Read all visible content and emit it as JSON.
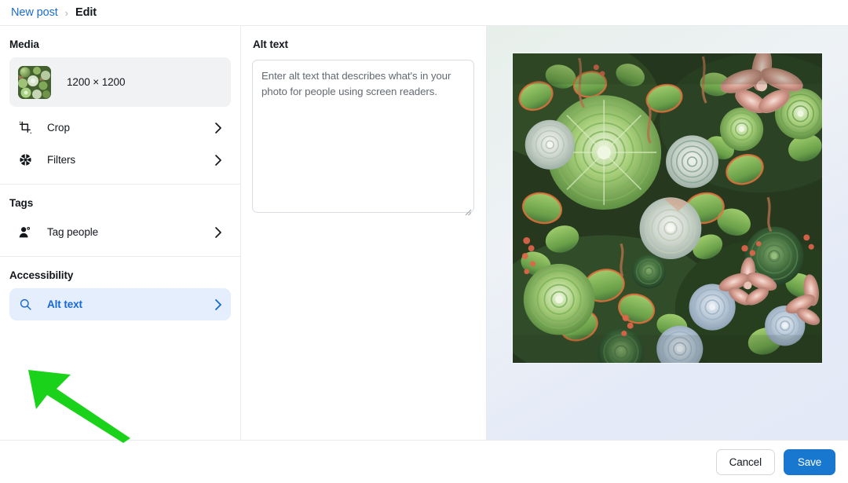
{
  "header": {
    "breadcrumb_parent": "New post",
    "breadcrumb_separator": "›",
    "breadcrumb_current": "Edit"
  },
  "sidebar": {
    "sections": [
      {
        "title": "Media",
        "media": {
          "dimensions": "1200 × 1200",
          "thumbnail_alt": "Succulent garden thumbnail"
        },
        "rows": [
          {
            "icon": "crop-icon",
            "label": "Crop",
            "chevron": "chevron-right-icon",
            "selected": false
          },
          {
            "icon": "filters-aperture-icon",
            "label": "Filters",
            "chevron": "chevron-right-icon",
            "selected": false
          }
        ]
      },
      {
        "title": "Tags",
        "rows": [
          {
            "icon": "tag-people-icon",
            "label": "Tag people",
            "chevron": "chevron-right-icon",
            "selected": false
          }
        ]
      },
      {
        "title": "Accessibility",
        "rows": [
          {
            "icon": "magnifier-icon",
            "label": "Alt text",
            "chevron": "chevron-right-icon",
            "selected": true
          }
        ]
      }
    ]
  },
  "alt_panel": {
    "title": "Alt text",
    "textarea_value": "",
    "textarea_placeholder": "Enter alt text that describes what's in your photo for people using screen readers.",
    "resize_handle": "resize-grip-icon"
  },
  "preview": {
    "image_alt": "Close-up overhead photo of a dense succulent garden with green, pink and pale blue rosettes"
  },
  "footer": {
    "cancel_label": "Cancel",
    "save_label": "Save"
  },
  "annotation": {
    "type": "arrow",
    "name": "green-pointer-arrow",
    "points_to": "Alt text",
    "color": "#19d219"
  },
  "colors": {
    "accent_blue": "#1a6dd1",
    "save_button_blue": "#1877cf",
    "selected_row_bg": "#e4eefc",
    "selected_row_text": "#1668d6",
    "media_card_bg": "#f1f2f3",
    "divider": "#e9ebee",
    "text_primary": "#13171c",
    "placeholder_text": "#636a72",
    "annotation_green": "#19d219"
  }
}
